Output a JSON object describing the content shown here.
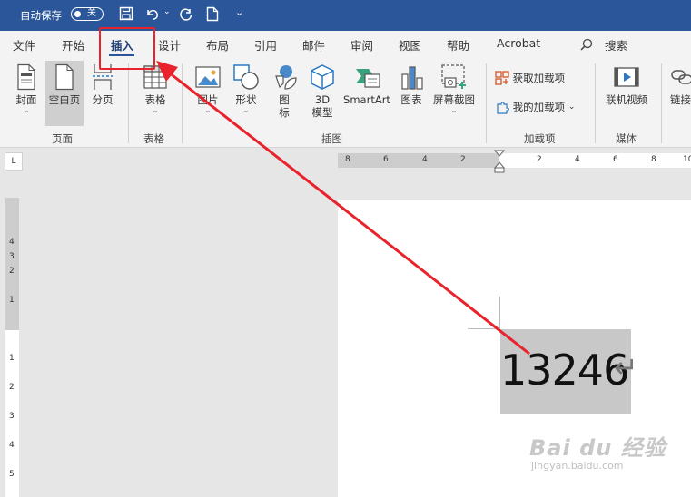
{
  "titlebar": {
    "autosave_label": "自动保存",
    "autosave_state": "关",
    "more_label": "⌄"
  },
  "tabs": [
    {
      "label": "文件"
    },
    {
      "label": "开始"
    },
    {
      "label": "插入"
    },
    {
      "label": "设计"
    },
    {
      "label": "布局"
    },
    {
      "label": "引用"
    },
    {
      "label": "邮件"
    },
    {
      "label": "审阅"
    },
    {
      "label": "视图"
    },
    {
      "label": "帮助"
    },
    {
      "label": "Acrobat"
    },
    {
      "label": "搜索"
    }
  ],
  "ribbon": {
    "buttons": {
      "cover": "封面",
      "blank_page": "空白页",
      "page_break": "分页",
      "table": "表格",
      "pictures": "图片",
      "shapes": "形状",
      "icons_line1": "图",
      "icons_line2": "标",
      "model3d_line1": "3D",
      "model3d_line2": "模型",
      "smartart": "SmartArt",
      "chart": "图表",
      "screenshot": "屏幕截图",
      "get_addins": "获取加载项",
      "my_addins": "我的加载项",
      "online_video": "联机视频",
      "link": "链接"
    },
    "groups": {
      "pages": "页面",
      "tables": "表格",
      "illustrations": "插图",
      "addins": "加载项",
      "media": "媒体"
    }
  },
  "ruler": {
    "corner": "L",
    "h_labels": [
      "8",
      "6",
      "4",
      "2",
      "2",
      "4",
      "6",
      "8",
      "10"
    ],
    "v_labels": [
      "4",
      "3",
      "2",
      "1",
      "1",
      "2",
      "3",
      "4",
      "5"
    ]
  },
  "document": {
    "text": "13246",
    "paragraph_mark": "↵"
  },
  "watermark": {
    "brand": "Bai du 经验",
    "url": "jingyan.baidu.com"
  },
  "colors": {
    "titlebar": "#2b579a",
    "callout": "#e8232c",
    "highlight": "#c8c8c8"
  }
}
